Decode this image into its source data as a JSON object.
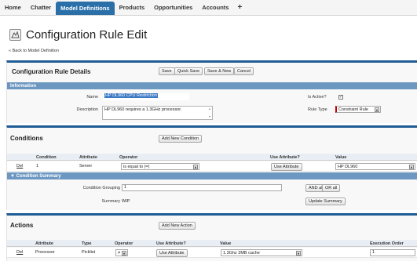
{
  "nav": {
    "tabs": [
      "Home",
      "Chatter",
      "Model Definitions",
      "Products",
      "Opportunities",
      "Accounts",
      "+"
    ],
    "active_tab": "Model Definitions"
  },
  "header": {
    "title": "Configuration Rule Edit",
    "back_link": "« Back to Model Definition"
  },
  "rule_details": {
    "title": "Configuration Rule Details",
    "buttons": [
      "Save",
      "Quick Save",
      "Save & New",
      "Cancel"
    ]
  },
  "information": {
    "title": "Information",
    "name_label": "Name",
    "name_value": "HP DL960 CPU Restriction",
    "description_label": "Description",
    "description_value": "HP DL960 requires a 1.3GHz processor.",
    "is_active_label": "Is Active?",
    "is_active": "✓",
    "rule_type_label": "Rule Type",
    "rule_type_value": "Constraint Rule"
  },
  "conditions": {
    "title": "Conditions",
    "add_button": "Add New Condition",
    "columns": [
      "Condition",
      "Attribute",
      "Operator",
      "Use Attribute?",
      "Value"
    ],
    "row": {
      "del": "Del",
      "condition": "1",
      "attribute": "Server",
      "operator": "is equal to (=)",
      "use_attribute_button": "Use Attribute",
      "value": "HP DL960"
    }
  },
  "condition_summary": {
    "title": "▼ Condition Summary",
    "grouping_label": "Condition Grouping",
    "grouping_value": "1",
    "and_all": "AND all",
    "or_all": "OR all",
    "summary_label": "Summary",
    "summary_value": "WIP",
    "update_button": "Update Summary"
  },
  "actions": {
    "title": "Actions",
    "add_button": "Add New Action",
    "columns": [
      "Attribute",
      "Type",
      "Operator",
      "Use Attribute?",
      "Value",
      "Execution Order"
    ],
    "row": {
      "del": "Del",
      "attribute": "Processor",
      "type": "Picklist",
      "operator": "≠",
      "use_attribute_button": "Use Attribute",
      "value": "1.3Ghz 3MB cache",
      "execution_order": "1"
    }
  },
  "colors": {
    "tab_active": "#2a6fa8",
    "panel_border": "#1f5c95",
    "section_bar": "#6c97c1",
    "required": "#c00000"
  }
}
